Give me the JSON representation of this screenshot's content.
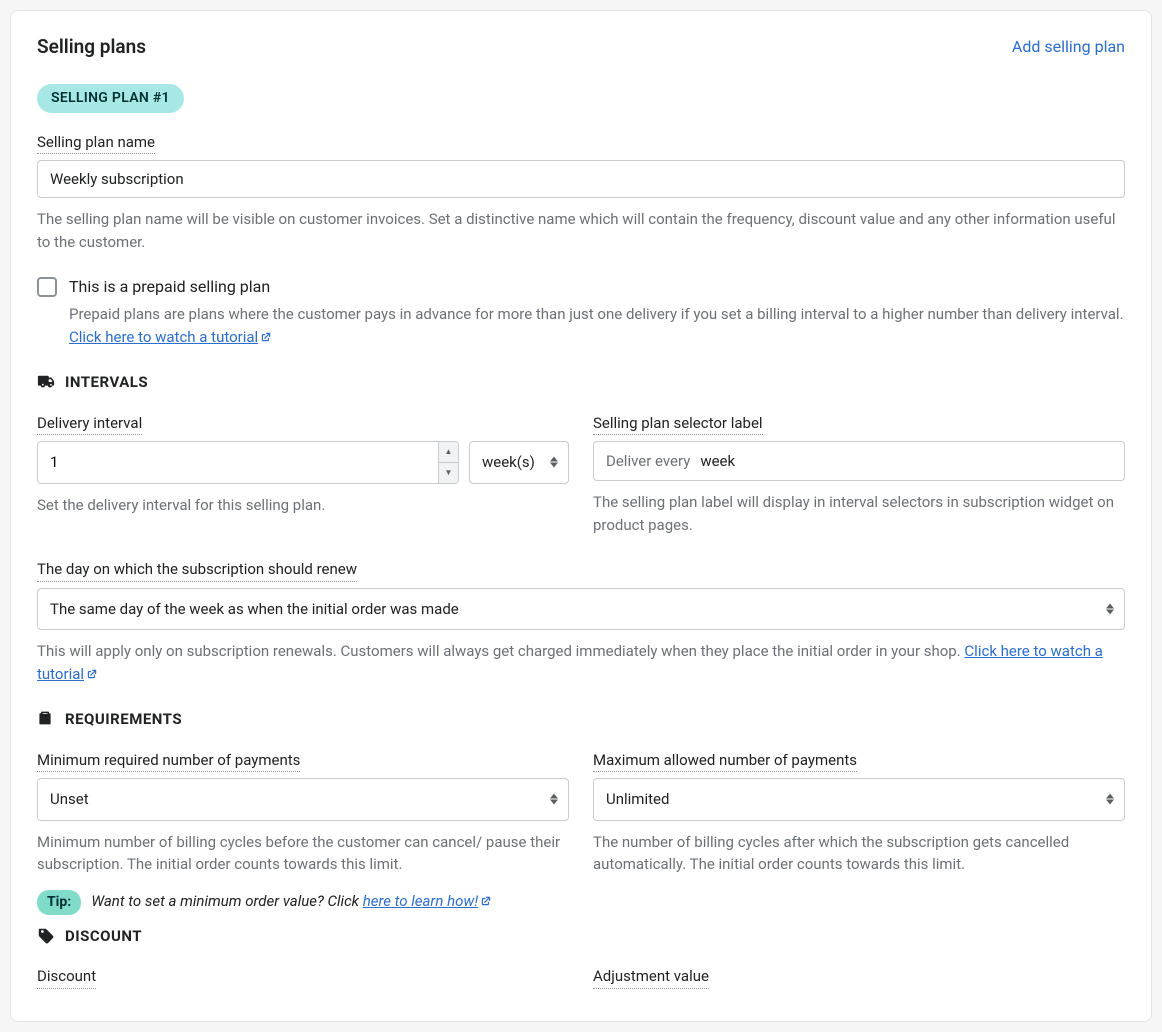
{
  "header": {
    "title": "Selling plans",
    "add_link": "Add selling plan"
  },
  "plan": {
    "badge": "SELLING PLAN #1",
    "name_label": "Selling plan name",
    "name_value": "Weekly subscription",
    "name_help": "The selling plan name will be visible on customer invoices. Set a distinctive name which will contain the frequency, discount value and any other information useful to the customer."
  },
  "prepaid": {
    "label": "This is a prepaid selling plan",
    "help_text": "Prepaid plans are plans where the customer pays in advance for more than just one delivery if you set a billing interval to a higher number than delivery interval. ",
    "link_text": "Click here to watch a tutorial"
  },
  "sections": {
    "intervals": "INTERVALS",
    "requirements": "REQUIREMENTS",
    "discount": "DISCOUNT"
  },
  "delivery": {
    "label": "Delivery interval",
    "value": "1",
    "unit": "week(s)",
    "help": "Set the delivery interval for this selling plan."
  },
  "selector_label": {
    "label": "Selling plan selector label",
    "prefix": "Deliver every",
    "value": "week",
    "help": "The selling plan label will display in interval selectors in subscription widget on product pages."
  },
  "renew": {
    "label": "The day on which the subscription should renew",
    "value": "The same day of the week as when the initial order was made",
    "help_text": "This will apply only on subscription renewals. Customers will always get charged immediately when they place the initial order in your shop. ",
    "link_text": "Click here to watch a tutorial"
  },
  "min_payments": {
    "label": "Minimum required number of payments",
    "value": "Unset",
    "help": "Minimum number of billing cycles before the customer can cancel/ pause their subscription. The initial order counts towards this limit."
  },
  "max_payments": {
    "label": "Maximum allowed number of payments",
    "value": "Unlimited",
    "help": "The number of billing cycles after which the subscription gets cancelled automatically. The initial order counts towards this limit."
  },
  "tip": {
    "badge": "Tip:",
    "text": "Want to set a minimum order value? Click ",
    "link": "here to learn how!"
  },
  "discount": {
    "discount_label": "Discount",
    "adjustment_label": "Adjustment value"
  }
}
